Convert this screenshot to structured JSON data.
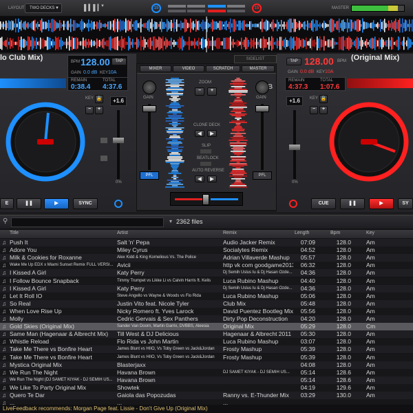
{
  "topbar": {
    "layout_label": "LAYOUT",
    "layout_value": "TWO DECKS",
    "deck_left": "15",
    "deck_right": "15",
    "master_label": "MASTER"
  },
  "deck_left": {
    "title": "lo Club Mix)",
    "bpm_label": "BPM",
    "bpm": "128.00",
    "gain_label": "GAIN",
    "gain": "0.0 dB",
    "key_label": "KEY",
    "key": "10A",
    "tap": "TAP",
    "remain_label": "REMAIN",
    "remain": "0:38.4",
    "total_label": "TOTAL",
    "total": "4:37.6",
    "key_side_label": "KEY",
    "pitch": "+1.6",
    "cue": "E",
    "sync": "SYNC",
    "pitch_scale": "0%",
    "accent": "#1e90ff"
  },
  "deck_right": {
    "title": "(Original Mix)",
    "bpm_label": "BPM",
    "bpm": "128.00",
    "gain_label": "GAIN",
    "gain": "0.0 dB",
    "key_label": "KEY",
    "key": "10A",
    "tap": "TAP",
    "remain_label": "REMAIN",
    "remain": "4:37.3",
    "total_label": "TOTAL",
    "total": "1:07.6",
    "key_side_label": "KEY",
    "pitch": "+1.6",
    "cue": "CUE",
    "sync": "SY",
    "pitch_scale": "0%",
    "accent": "#ff2020"
  },
  "mixer": {
    "tab_mixer": "MIXER",
    "tab_video": "VIDEO",
    "tab_scratch": "SCRATCH",
    "tab_master": "MASTER",
    "sidelist": "SIDELIST",
    "gain_left": "GAIN",
    "gain_right": "GAIN",
    "zoom": "ZOOM",
    "clone_deck": "CLONE DECK",
    "slip": "SLIP",
    "beatlock": "BEATLOCK",
    "auto_reverse": "AUTO REVERSE",
    "pfl_left": "PFL",
    "pfl_right": "PFL",
    "label_a": "A",
    "label_b": "B"
  },
  "browser": {
    "file_count": "2362 files",
    "columns": [
      "Title",
      "Artist",
      "Remix",
      "Length",
      "Bpm",
      "Key"
    ],
    "rows": [
      [
        "Push It",
        "Salt 'n' Pepa",
        "Audio Jacker Remix",
        "07:09",
        "128.0",
        "Am"
      ],
      [
        "Adore You",
        "Miley Cyrus",
        "Socialytes Remix",
        "04:52",
        "128.0",
        "Am"
      ],
      [
        "Milk & Cookies for Roxanne",
        "Alex Kidd & King Kornelious Vs. The Police",
        "Adrian Villaverde Mashup",
        "05:57",
        "128.0",
        "Am"
      ],
      [
        "Wake Me Up EDX x Miami Sunset Remix FULL VERSI...",
        "Avicii",
        "http vk com goodgame2013",
        "06:32",
        "128.0",
        "Am"
      ],
      [
        "I Kissed A Girl",
        "Katy Perry",
        "Dj Semih Uslus Iu & Dj Hasan Ozde...",
        "04:36",
        "128.0",
        "Am"
      ],
      [
        "I Follow Bounce Snapback",
        "Timmy Trumpet vs Likke Li vs Calvin Harris ft. Kelis",
        "Luca Rubino Mashup",
        "04:40",
        "128.0",
        "Am"
      ],
      [
        "I Kissed A Girl",
        "Katy Perry",
        "Dj Semih Uslus Iu & Dj Hasan Ozde...",
        "04:36",
        "128.0",
        "Am"
      ],
      [
        "Let It Roll IO",
        "Steve Angello vs Wayne & Woods vs Flo Rida",
        "Luca Rubino Mashup",
        "05:06",
        "128.0",
        "Am"
      ],
      [
        "So Real",
        "Justin Vito feat. Nicole Tyler",
        "Club Mix",
        "05:48",
        "128.0",
        "Am"
      ],
      [
        "When Love Rise Up",
        "Nicky Romero ft. Yves Larock",
        "David Puentez Bootleg Mix",
        "05:56",
        "128.0",
        "Am"
      ],
      [
        "Molly",
        "Cedric Gervais & Sex Panthers",
        "Dirty Pop Deconstruction",
        "04:20",
        "128.0",
        "Am"
      ],
      [
        "Gold Skies (Original Mix)",
        "Sander Van Doorn, Martin Garrix, DVBBS, Aleesia",
        "Original Mix",
        "05:29",
        "128.0",
        "Cm"
      ],
      [
        "Same Man (Hagenaar & Albrecht Mix)",
        "Till West & DJ Delicious",
        "Hagenaar & Albrecht 2011 Mix",
        "05:30",
        "128.0",
        "Am"
      ],
      [
        "Whistle Reload",
        "Flo Rida vs John Martin",
        "Luca Rubino Mashup",
        "03:07",
        "128.0",
        "Am"
      ],
      [
        "Take Me There vs Bonfire Heart",
        "James Blunt vs HIIO, Vs Toby Green vs Jack&Jordan",
        "Frosty Mashup",
        "05:39",
        "128.0",
        "Am"
      ],
      [
        "Take Me There vs Bonfire Heart",
        "James Blunt vs HIIO, Vs Toby Green vs Jack&Jordan",
        "Frosty Mashup",
        "05:39",
        "128.0",
        "Am"
      ],
      [
        "Mystica Original Mix",
        "Blasterjaxx",
        "",
        "04:08",
        "128.0",
        "Am"
      ],
      [
        "We Run The Night",
        "Havana Brown",
        "DJ SAMET KIYAK - DJ SEMIH US...",
        "05:14",
        "128.6",
        "Am"
      ],
      [
        "We Run The Night (DJ SAMET KIYAK - DJ SEMIH US...",
        "Havana Brown",
        "",
        "05:14",
        "128.6",
        "Am"
      ],
      [
        "We Like To Party Original Mix",
        "Showtek",
        "",
        "04:19",
        "129.6",
        "Am"
      ],
      [
        "Quero Te Dar",
        "Gaiola das Popozudas",
        "Ranny vs. E-Thunder Mix",
        "03:29",
        "130.0",
        "Am"
      ],
      [
        "...",
        "...",
        "...",
        "",
        "",
        ""
      ]
    ],
    "highlight_row": 11,
    "livefeed": "LiveFeedback recommends: Morgan Page feat. Lissie - Don't Give Up (Original Mix)"
  }
}
